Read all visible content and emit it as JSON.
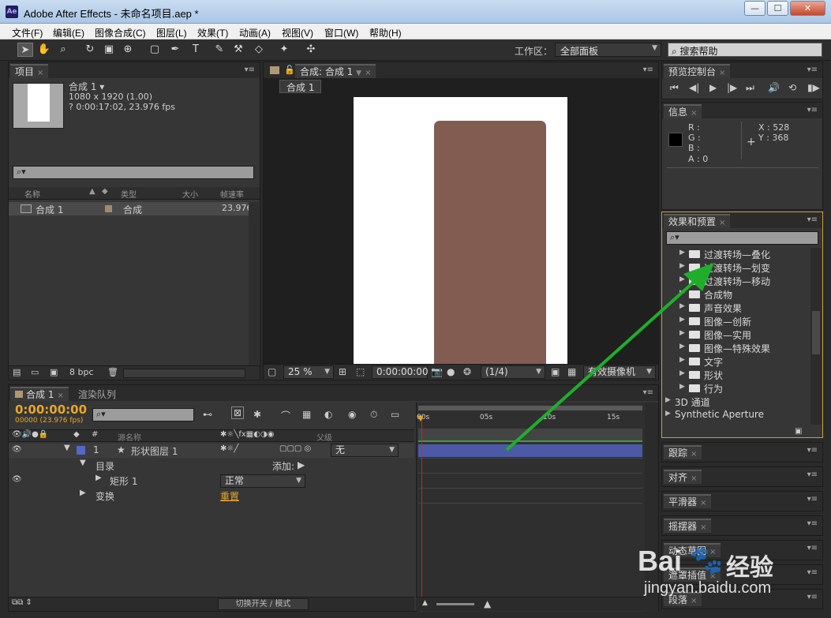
{
  "window": {
    "title": "Adobe After Effects - 未命名项目.aep *",
    "app_icon_text": "Ae",
    "min_label": "—",
    "max_label": "☐",
    "close_label": "✕"
  },
  "menu": [
    "文件(F)",
    "编辑(E)",
    "图像合成(C)",
    "图层(L)",
    "效果(T)",
    "动画(A)",
    "视图(V)",
    "窗口(W)",
    "帮助(H)"
  ],
  "toolbar": {
    "workspace_label": "工作区：",
    "workspace_value": "全部面板",
    "help_search": "搜索帮助"
  },
  "project": {
    "tab": "项目",
    "comp_name": "合成 1 ▾",
    "comp_size": "1080 x 1920 (1.00)",
    "comp_duration": "? 0:00:17:02, 23.976 fps",
    "columns": {
      "name": "名称",
      "type": "类型",
      "size": "大小",
      "fps": "帧速率"
    },
    "rows": [
      {
        "name": "合成 1",
        "type": "合成",
        "fps": "23.976"
      }
    ],
    "bpc": "8 bpc"
  },
  "composition": {
    "tab": "合成: 合成 1",
    "subtab": "合成 1",
    "zoom": "25 %",
    "timecode": "0:00:00:00",
    "resolution": "(1/4)",
    "camera": "有效摄像机",
    "colors": {
      "canvas": "#ffffff",
      "shape": "#825b51"
    }
  },
  "preview": {
    "tab": "预览控制台"
  },
  "info": {
    "tab": "信息",
    "r": "R :",
    "g": "G :",
    "b": "B :",
    "a": "A : 0",
    "x": "X : 528",
    "y": "Y : 368"
  },
  "effects": {
    "tab": "效果和预置",
    "items": [
      "过渡转场—叠化",
      "过渡转场—划变",
      "过渡转场—移动",
      "合成物",
      "声音效果",
      "图像—创新",
      "图像—实用",
      "图像—特殊效果",
      "文字",
      "形状",
      "行为"
    ],
    "top_items": [
      "3D 通道",
      "Synthetic Aperture"
    ]
  },
  "side_panels": [
    "跟踪",
    "对齐",
    "平滑器",
    "摇摆器",
    "动态草图",
    "遮罩插值",
    "段落"
  ],
  "timeline": {
    "tab": "合成 1",
    "tab2": "渲染队列",
    "timecode": "0:00:00:00",
    "frames": "00000 (23.976 fps)",
    "col_source": "源名称",
    "col_parent": "父级",
    "ruler": [
      "00s",
      "05s",
      "10s",
      "15s"
    ],
    "layer": {
      "num": "1",
      "name": "形状图层 1",
      "parent": "无",
      "color": "#5468c8"
    },
    "rows": [
      {
        "label": "目录",
        "extra": "添加:"
      },
      {
        "label": "矩形 1",
        "extra": "正常"
      },
      {
        "label": "变换",
        "extra": "重置"
      }
    ],
    "toggle_label": "切换开关 / 模式"
  },
  "watermark": {
    "text1": "Bai",
    "text2": "经验",
    "url": "jingyan.baidu.com"
  }
}
